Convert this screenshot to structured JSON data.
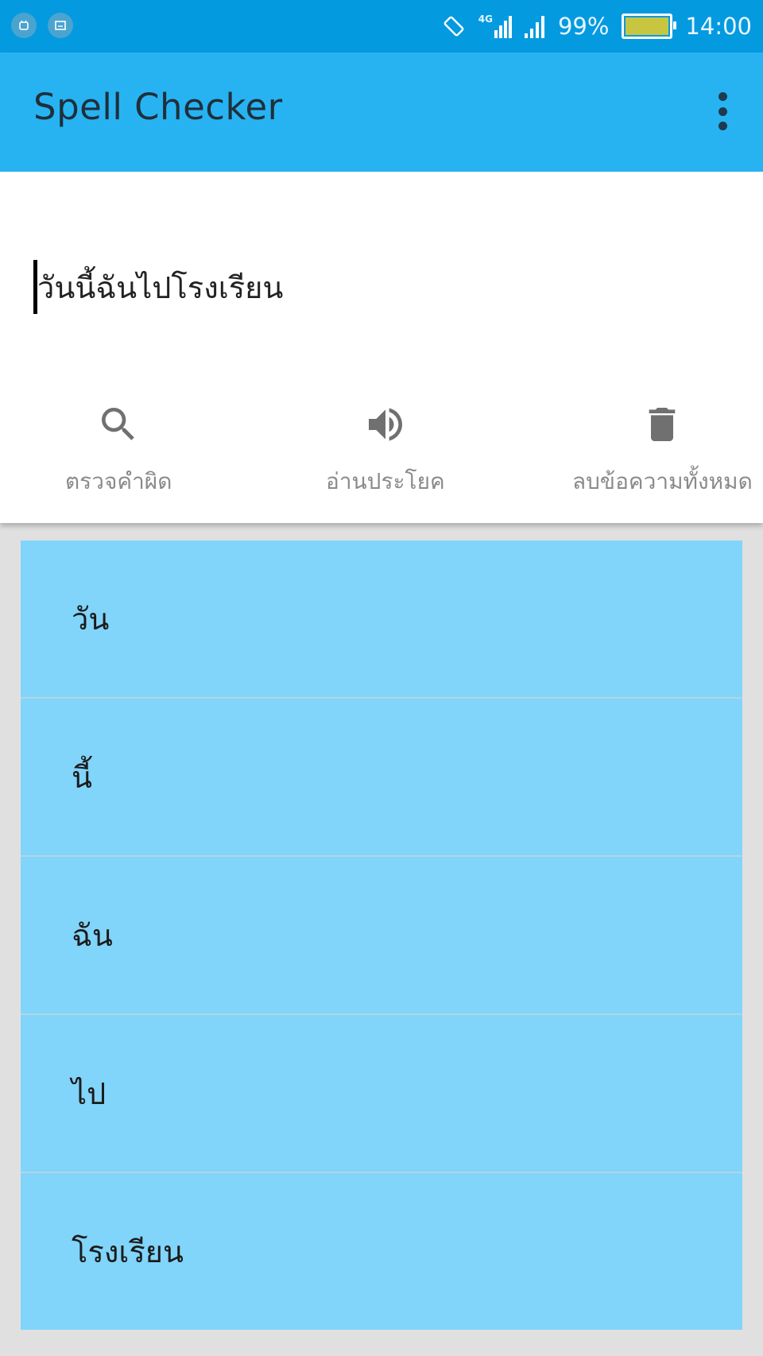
{
  "status_bar": {
    "battery_percent": "99%",
    "time": "14:00",
    "network": "4G",
    "icons": [
      "android-notification-icon",
      "screenshot-notification-icon",
      "rotate-icon",
      "signal-4g-icon",
      "signal-icon",
      "battery-icon"
    ],
    "background": "#049ae0",
    "battery_level": 0.99
  },
  "app_bar": {
    "title": "Spell Checker",
    "background": "#27b3f2",
    "menu_icon": "more-vert-icon"
  },
  "editor": {
    "value": "วันนี้ฉันไปโรงเรียน"
  },
  "actions": [
    {
      "label": "ตรวจคำผิด",
      "icon": "search-icon"
    },
    {
      "label": "อ่านประโยค",
      "icon": "volume-icon"
    },
    {
      "label": "ลบข้อความทั้งหมด",
      "icon": "delete-icon"
    }
  ],
  "words": [
    {
      "text": "วัน"
    },
    {
      "text": "นี้"
    },
    {
      "text": "ฉัน"
    },
    {
      "text": "ไป"
    },
    {
      "text": "โรงเรียน"
    }
  ],
  "colors": {
    "word_row": "#81d4fa",
    "action_gray": "#707070",
    "page_background": "#e0e0e0"
  }
}
